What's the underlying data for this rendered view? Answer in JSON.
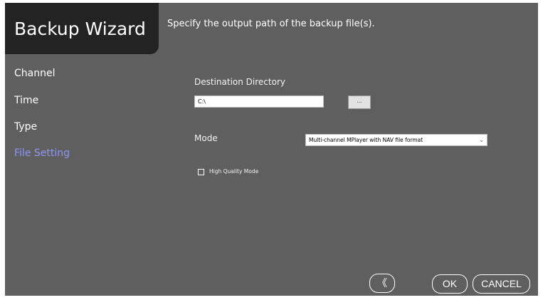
{
  "window": {
    "title": "Backup Wizard",
    "instruction": "Specify the output path of the backup file(s)."
  },
  "sidebar": {
    "items": [
      {
        "label": "Channel",
        "active": false
      },
      {
        "label": "Time",
        "active": false
      },
      {
        "label": "Type",
        "active": false
      },
      {
        "label": "File Setting",
        "active": true
      }
    ],
    "active_color": "#8f96f2"
  },
  "destination": {
    "label": "Destination Directory",
    "value": "C:\\",
    "browse_label": "..."
  },
  "mode": {
    "label": "Mode",
    "selected": "Multi-channel MPlayer with NAV file format",
    "chevron_icon": "chevron-down-icon"
  },
  "high_quality": {
    "label": "High Quality Mode",
    "checked": false
  },
  "footer": {
    "back_icon": "double-chevron-left-icon",
    "back_glyph": "《",
    "ok_label": "OK",
    "cancel_label": "CANCEL"
  },
  "colors": {
    "panel_bg": "#5f5f5f",
    "title_bg": "#232323",
    "text": "#ffffff"
  }
}
